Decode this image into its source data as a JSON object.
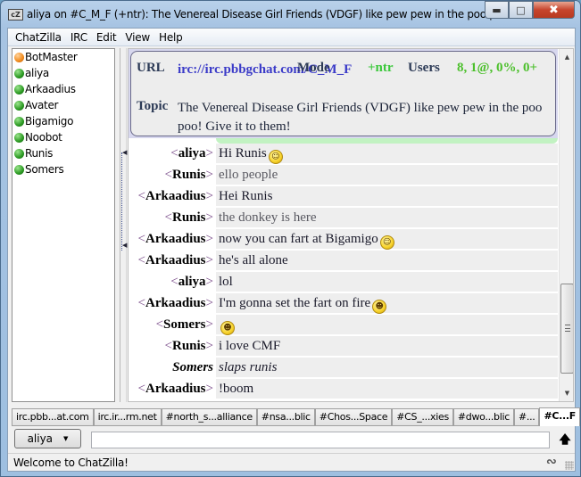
{
  "window": {
    "title": "aliya on #C_M_F (+ntr): The Venereal Disease Girl Friends (VDGF) like pew pew in the poo poo...",
    "app_icon": "cZ",
    "minimize_icon": "minimize-icon",
    "maximize_icon": "maximize-icon",
    "close_icon": "close-icon"
  },
  "menu": {
    "items": [
      {
        "label": "ChatZilla"
      },
      {
        "label": "IRC"
      },
      {
        "label": "Edit"
      },
      {
        "label": "View"
      },
      {
        "label": "Help"
      }
    ]
  },
  "userlist": {
    "users": [
      {
        "name": "BotMaster",
        "status": "op"
      },
      {
        "name": "aliya",
        "status": "normal"
      },
      {
        "name": "Arkaadius",
        "status": "normal"
      },
      {
        "name": "Avater",
        "status": "normal"
      },
      {
        "name": "Bigamigo",
        "status": "normal"
      },
      {
        "name": "Noobot",
        "status": "normal"
      },
      {
        "name": "Runis",
        "status": "normal"
      },
      {
        "name": "Somers",
        "status": "normal"
      }
    ]
  },
  "header": {
    "url_label": "URL",
    "url": "irc://irc.pbbgchat.com/C_M_F",
    "mode_label": "Mode",
    "mode": "+ntr",
    "users_label": "Users",
    "users": "8, 1@, 0%, 0+",
    "topic_label": "Topic",
    "topic": "The Venereal Disease Girl Friends (VDGF) like pew pew in the poo poo! Give it to them!"
  },
  "messages": [
    {
      "open": "<",
      "nick": "aliya",
      "close": ">",
      "text": "Hi Runis",
      "smiley": "smile",
      "type": "self"
    },
    {
      "open": "<",
      "nick": "Runis",
      "close": ">",
      "text": "ello people",
      "smiley": "",
      "type": "other"
    },
    {
      "open": "<",
      "nick": "Arkaadius",
      "close": ">",
      "text": "Hei Runis",
      "smiley": "",
      "type": "self"
    },
    {
      "open": "<",
      "nick": "Runis",
      "close": ">",
      "text": "the donkey is here",
      "smiley": "",
      "type": "other"
    },
    {
      "open": "<",
      "nick": "Arkaadius",
      "close": ">",
      "text": "now you can fart at Bigamigo",
      "smiley": "wink",
      "type": "self"
    },
    {
      "open": "<",
      "nick": "Arkaadius",
      "close": ">",
      "text": "he's all alone",
      "smiley": "",
      "type": "self"
    },
    {
      "open": "<",
      "nick": "aliya",
      "close": ">",
      "text": "lol",
      "smiley": "",
      "type": "self"
    },
    {
      "open": "<",
      "nick": "Arkaadius",
      "close": ">",
      "text": "I'm gonna set the fart on fire",
      "smiley": "grin",
      "type": "self"
    },
    {
      "open": "<",
      "nick": "Somers",
      "close": ">",
      "text": "",
      "smiley": "grin",
      "type": "self"
    },
    {
      "open": "<",
      "nick": "Runis",
      "close": ">",
      "text": "i love CMF",
      "smiley": "",
      "type": "self"
    },
    {
      "open": "",
      "nick": "Somers",
      "close": "",
      "text": "slaps runis",
      "smiley": "",
      "type": "action"
    },
    {
      "open": "<",
      "nick": "Arkaadius",
      "close": ">",
      "text": "!boom",
      "smiley": "",
      "type": "self"
    }
  ],
  "smileys": {
    "smile": "☺",
    "wink": "☺",
    "grin": "☻"
  },
  "tabs": [
    {
      "label": "irc.pbb...at.com",
      "active": false
    },
    {
      "label": "irc.ir...rm.net",
      "active": false
    },
    {
      "label": "#north_s...alliance",
      "active": false
    },
    {
      "label": "#nsa...blic",
      "active": false
    },
    {
      "label": "#Chos...Space",
      "active": false
    },
    {
      "label": "#CS_...xies",
      "active": false
    },
    {
      "label": "#dwo...blic",
      "active": false
    },
    {
      "label": "#...",
      "active": false
    },
    {
      "label": "#C...F",
      "active": true
    }
  ],
  "input": {
    "nick_button": "aliya",
    "value": "",
    "placeholder": ""
  },
  "status": {
    "text": "Welcome to ChatZilla!"
  },
  "colors": {
    "url": "#3a3ac8",
    "mode": "#3cc83c",
    "users": "#4cc02c",
    "op_dot": "#f08a1c",
    "normal_dot": "#2c9a23"
  }
}
